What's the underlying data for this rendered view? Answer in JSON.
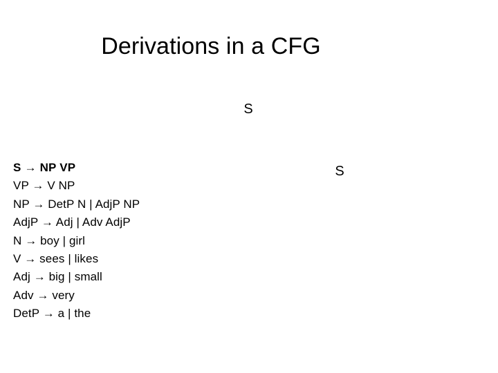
{
  "slide": {
    "title": "Derivations in a CFG",
    "background_color": "#ffffff",
    "text_color": "#000000"
  },
  "derivation": {
    "nodes": [
      {
        "label": "S",
        "position": "top-center"
      },
      {
        "label": "S",
        "position": "right"
      }
    ]
  },
  "grammar": {
    "rules": [
      {
        "text": "S → NP VP",
        "bold": true
      },
      {
        "text": "VP →  V NP",
        "bold": false
      },
      {
        "text": "NP → DetP N | AdjP NP",
        "bold": false
      },
      {
        "text": "AdjP →  Adj | Adv AdjP",
        "bold": false
      },
      {
        "text": "N →  boy | girl",
        "bold": false
      },
      {
        "text": "V →  sees | likes",
        "bold": false
      },
      {
        "text": "Adj →  big | small",
        "bold": false
      },
      {
        "text": "Adv →  very",
        "bold": false
      },
      {
        "text": "DetP →  a | the",
        "bold": false
      }
    ]
  }
}
